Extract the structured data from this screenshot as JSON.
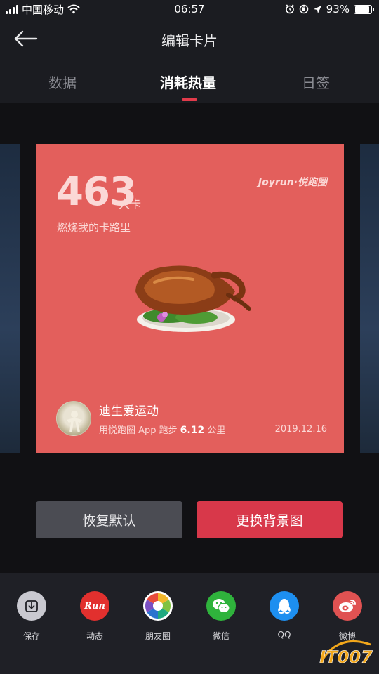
{
  "status_bar": {
    "carrier": "中国移动",
    "time": "06:57",
    "battery_percent": "93%",
    "battery_level": 0.93,
    "icons": [
      "signal-icon",
      "wifi-icon",
      "alarm-icon",
      "rotation-lock-icon",
      "location-icon",
      "battery-icon"
    ]
  },
  "nav": {
    "back_icon": "arrow-left-icon",
    "title": "编辑卡片"
  },
  "tabs": [
    {
      "label": "数据",
      "active": false
    },
    {
      "label": "消耗热量",
      "active": true
    },
    {
      "label": "日签",
      "active": false
    }
  ],
  "card": {
    "calories": "463",
    "unit": "大卡",
    "subtitle": "燃烧我的卡路里",
    "brand": "Joyrun·悦跑圈",
    "image": "roast-duck-image",
    "username": "迪生爱运动",
    "run_prefix": "用悦跑圈 App 跑步",
    "distance": "6.12",
    "distance_unit": "公里",
    "date": "2019.12.16",
    "background": "#e35f5c"
  },
  "buttons": {
    "reset": "恢复默认",
    "change_background": "更换背景图"
  },
  "share": [
    {
      "label": "保存",
      "icon": "download-icon",
      "color": "#c9c9d0"
    },
    {
      "label": "动态",
      "icon": "run-icon",
      "color": "#e2302e"
    },
    {
      "label": "朋友圈",
      "icon": "moments-icon",
      "color": "#ffffff"
    },
    {
      "label": "微信",
      "icon": "wechat-icon",
      "color": "#2fb33c"
    },
    {
      "label": "QQ",
      "icon": "qq-icon",
      "color": "#1d8ff0"
    },
    {
      "label": "微博",
      "icon": "weibo-icon",
      "color": "#e05252"
    }
  ],
  "watermark": {
    "text": "IT007"
  },
  "colors": {
    "accent": "#d8384a",
    "background": "#111114",
    "bar": "#1b1c21"
  }
}
